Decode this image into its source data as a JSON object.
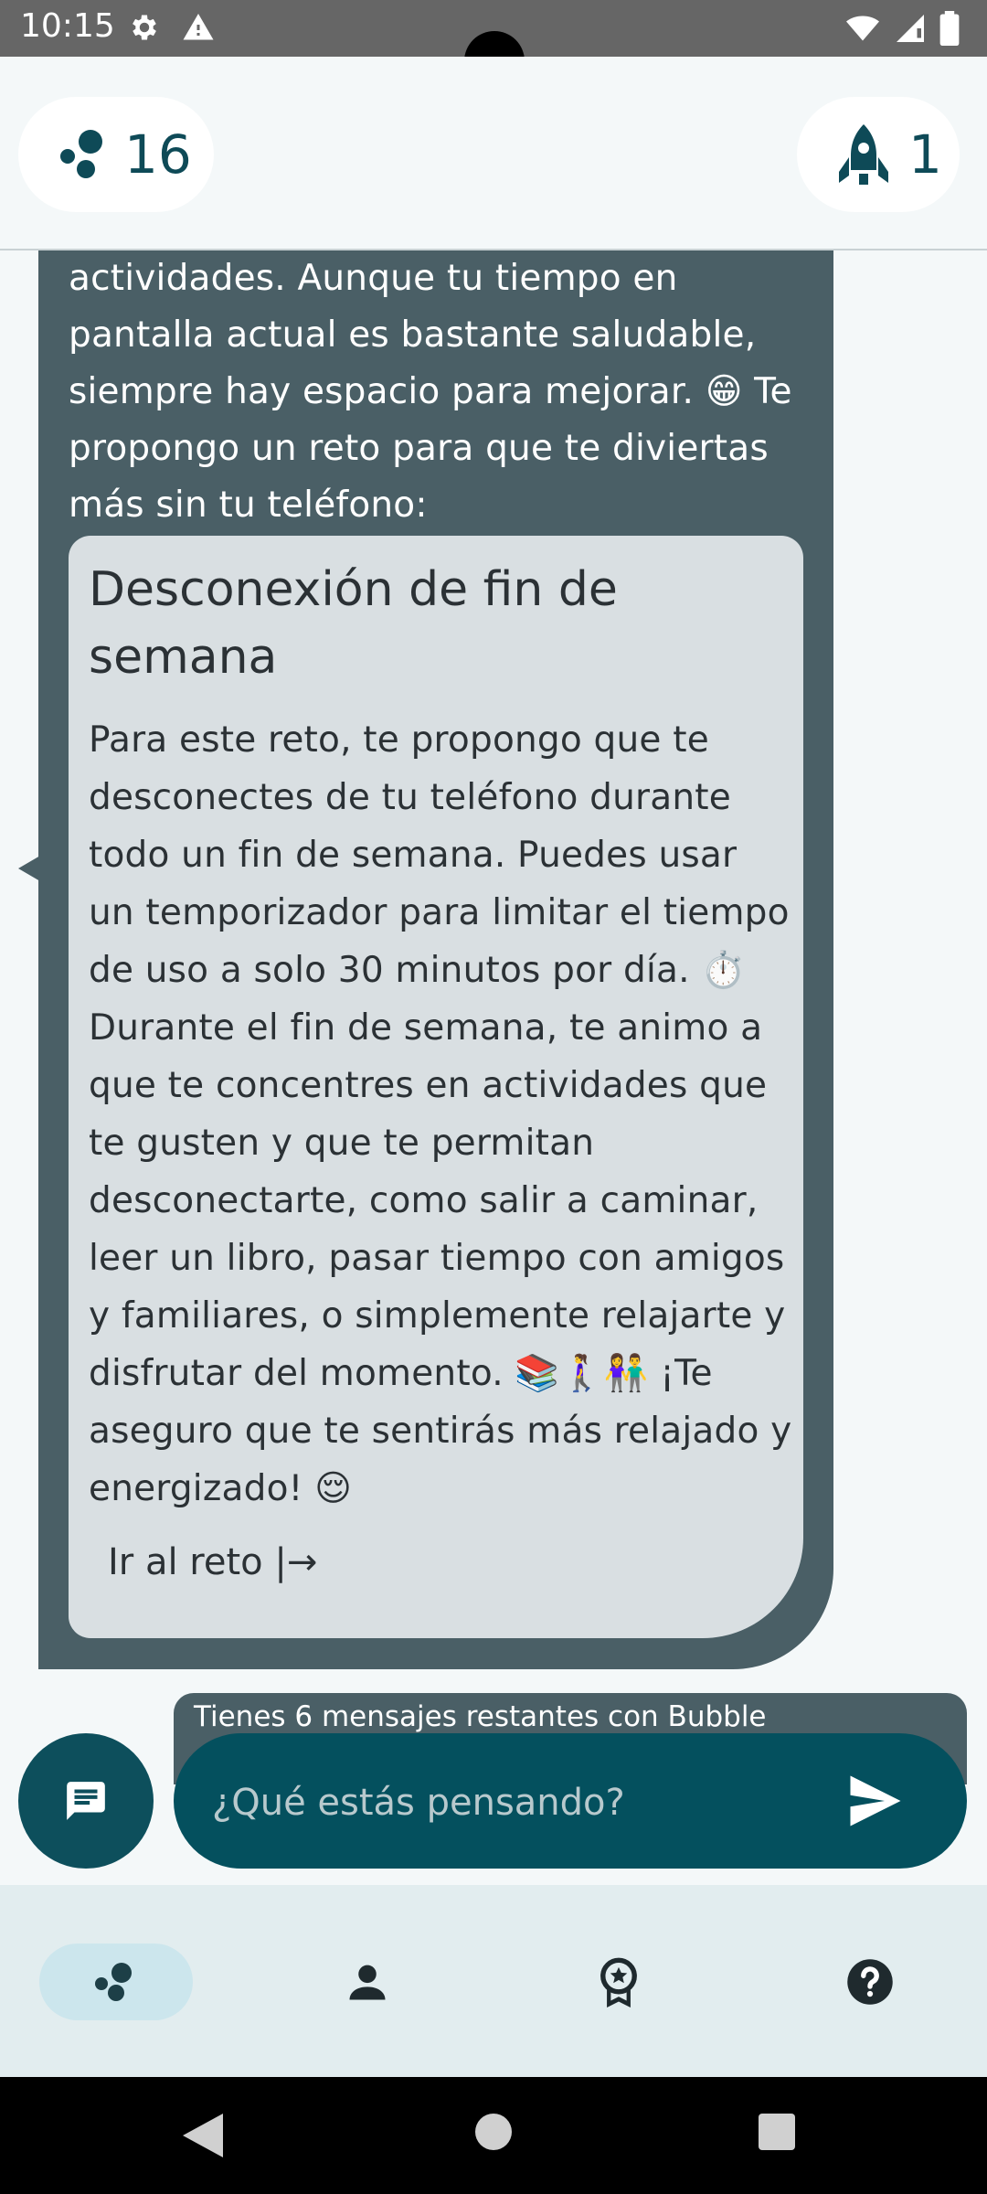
{
  "status_bar": {
    "time": "10:15",
    "left_icons": [
      "gear-icon",
      "warning-icon"
    ],
    "right_icons": [
      "wifi-icon",
      "signal-icon",
      "battery-icon"
    ]
  },
  "header": {
    "bubbles_count": "16",
    "rocket_count": "1"
  },
  "message": {
    "text": "actividades. Aunque tu tiempo en pantalla actual es bastante saludable, siempre hay espacio para mejorar. 😁 Te propongo un reto para que te diviertas más sin tu teléfono:",
    "challenge": {
      "title": "Desconexión de fin de semana",
      "body": "Para este reto, te propongo que te desconectes de tu teléfono durante todo un fin de semana. Puedes usar un temporizador para limitar el tiempo de uso a solo 30 minutos por día. ⏱️ Durante el fin de semana, te animo a que te concentres en actividades que te gusten y que te permitan desconectarte, como salir a caminar, leer un libro, pasar tiempo con amigos y familiares, o simplemente relajarte y disfrutar del momento. 📚🚶‍♀️👫 ¡Te aseguro que te sentirás más relajado y energizado! 😌",
      "link_label": "Ir al reto |→"
    }
  },
  "banner": {
    "text": "Tienes 6 mensajes restantes con Bubble"
  },
  "input": {
    "placeholder": "¿Qué estás pensando?"
  },
  "bottom_nav": {
    "items": [
      "bubbles-icon",
      "person-icon",
      "badge-icon",
      "help-icon"
    ],
    "active_index": 0
  },
  "colors": {
    "accent": "#04505e",
    "bubble": "#4a5f66",
    "card": "#d9dfe2",
    "nav_bg": "#e2edef",
    "nav_active": "#cce6ed"
  }
}
